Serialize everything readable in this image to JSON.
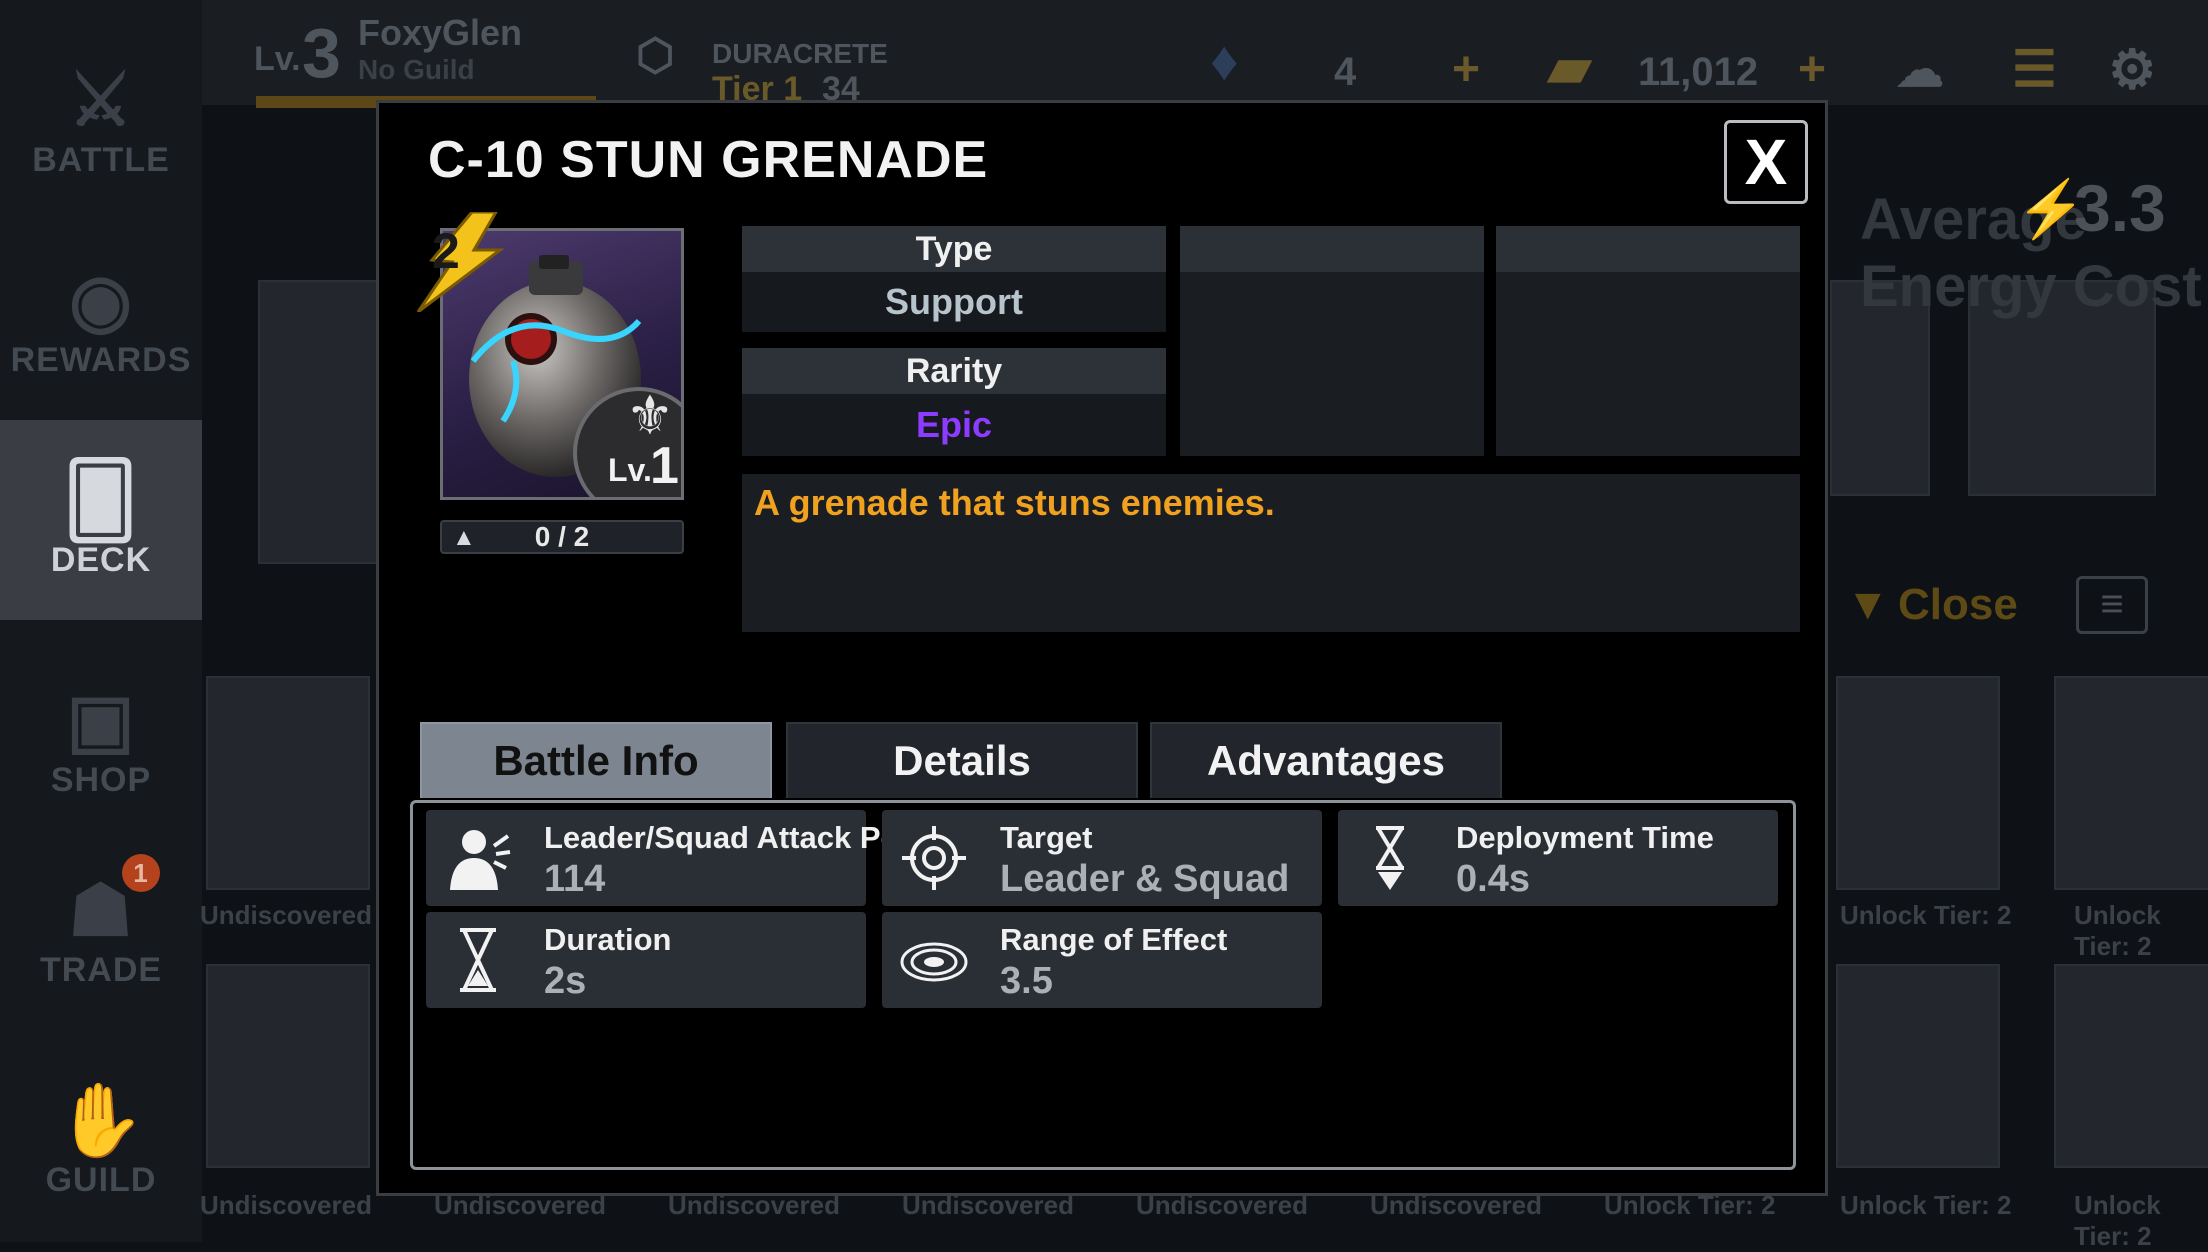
{
  "player": {
    "level_prefix": "Lv.",
    "level": "3",
    "name": "FoxyGlen",
    "guild": "No Guild"
  },
  "arena": {
    "name": "DURACRETE",
    "tier": "Tier 1",
    "rating": "34"
  },
  "currency": {
    "crystals": "4",
    "credits": "11,012"
  },
  "sidebar": {
    "items": [
      {
        "label": "BATTLE",
        "icon": "crossed-sabers-icon"
      },
      {
        "label": "REWARDS",
        "icon": "rewards-icon"
      },
      {
        "label": "DECK",
        "icon": "cards-icon"
      },
      {
        "label": "SHOP",
        "icon": "crate-icon"
      },
      {
        "label": "TRADE",
        "icon": "trade-icon",
        "badge": "1"
      },
      {
        "label": "GUILD",
        "icon": "handshake-icon"
      }
    ]
  },
  "background": {
    "avg_energy_label": "Average Energy Cost",
    "avg_energy_value": "3.3",
    "close_label": "Close",
    "undiscovered": "Undiscovered",
    "unlock_tier": "Unlock Tier: 2"
  },
  "modal": {
    "title": "C-10 STUN GRENADE",
    "close": "X",
    "card": {
      "energy_cost": "2",
      "level_prefix": "Lv.",
      "level": "1",
      "progress": "0 / 2"
    },
    "info": {
      "type_label": "Type",
      "type_value": "Support",
      "rarity_label": "Rarity",
      "rarity_value": "Epic",
      "rarity_color": "#8d3cff"
    },
    "description": "A grenade that stuns enemies.",
    "tabs": [
      "Battle Info",
      "Details",
      "Advantages"
    ],
    "stats": [
      {
        "label": "Leader/Squad Attack Power",
        "value": "114",
        "icon": "trooper-attack-icon"
      },
      {
        "label": "Target",
        "value": "Leader & Squad",
        "icon": "crosshair-icon"
      },
      {
        "label": "Deployment Time",
        "value": "0.4s",
        "icon": "deploy-hourglass-icon"
      },
      {
        "label": "Duration",
        "value": "2s",
        "icon": "hourglass-icon"
      },
      {
        "label": "Range of Effect",
        "value": "3.5",
        "icon": "radius-icon"
      }
    ]
  }
}
